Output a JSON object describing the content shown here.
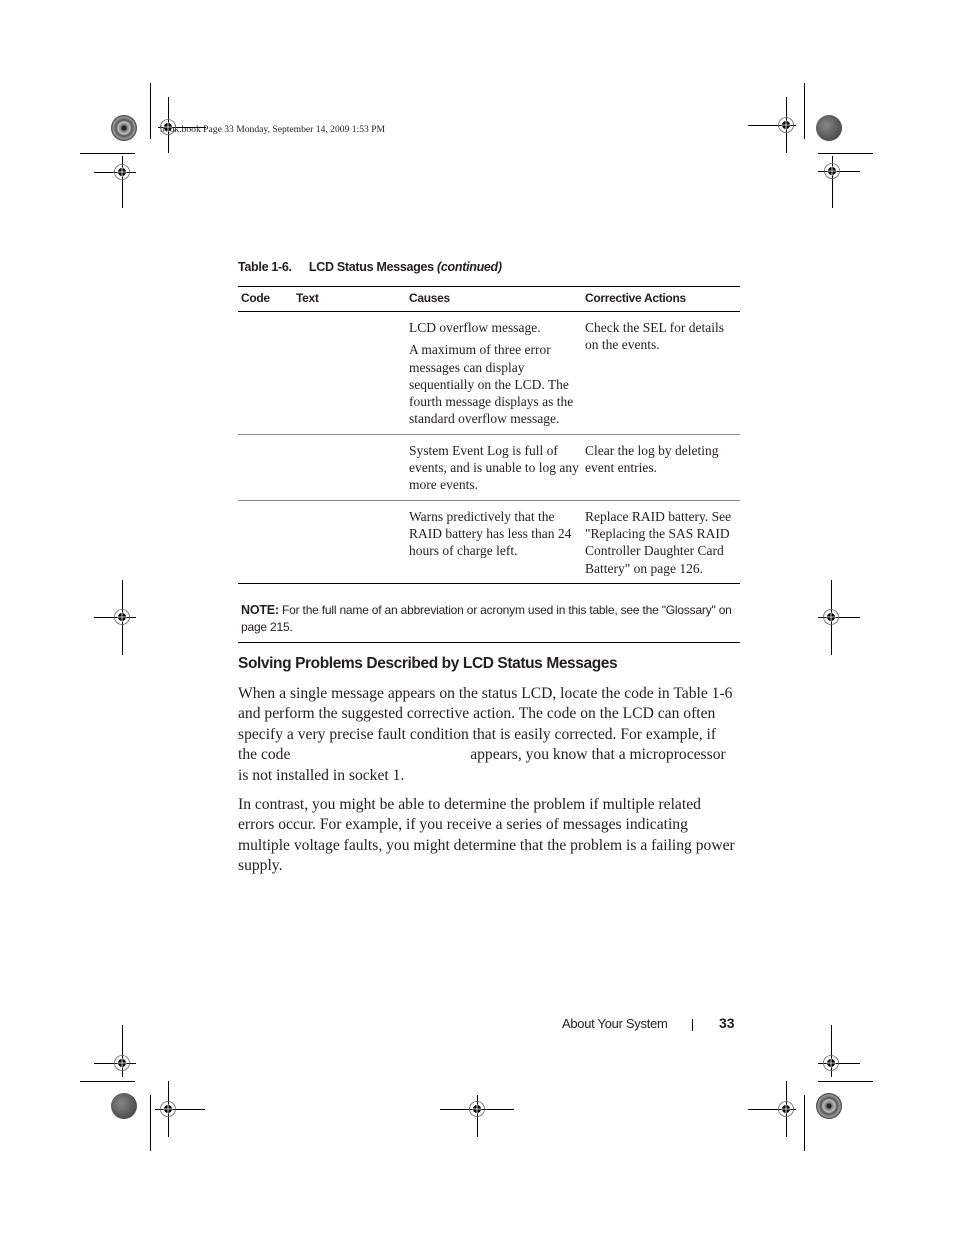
{
  "slug_line": "book.book  Page 33  Monday, September 14, 2009  1:53 PM",
  "table": {
    "caption_number": "Table 1-6.",
    "caption_title": "LCD Status Messages",
    "caption_suffix": "(continued)",
    "headers": [
      "Code",
      "Text",
      "Causes",
      "Corrective Actions"
    ],
    "rows": [
      {
        "code": "",
        "text": "",
        "causes": [
          "LCD overflow message.",
          "A maximum of three error messages can display sequentially on the LCD. The fourth message displays as the standard overflow message."
        ],
        "actions": "Check the SEL for details on the events."
      },
      {
        "code": "",
        "text": "",
        "causes": [
          "System Event Log is full of events, and is unable to log any more events."
        ],
        "actions": "Clear the log by deleting event entries."
      },
      {
        "code": "",
        "text": "",
        "causes": [
          "Warns predictively that the RAID battery has less than 24 hours of charge left."
        ],
        "actions": "Replace RAID battery. See \"Replacing the SAS RAID Controller Daughter Card Battery\" on page 126."
      }
    ]
  },
  "note": {
    "label": "NOTE:",
    "text": " For the full name of an abbreviation or acronym used in this table, see the \"Glossary\" on page 215."
  },
  "section": {
    "heading": "Solving Problems Described by LCD Status Messages",
    "paragraph1_before": "When a single message appears on the status LCD, locate the code in Table 1-6 and perform the suggested corrective action. The code on the LCD can often specify a very precise fault condition that is easily corrected. For example, if the code ",
    "paragraph1_after": " appears, you know that a microprocessor is not installed in socket 1.",
    "paragraph2": "In contrast, you might be able to determine the problem if multiple related errors occur. For example, if you receive a series of messages indicating multiple voltage faults, you might determine that the problem is a failing power supply."
  },
  "footer": {
    "chapter": "About Your System",
    "page_number": "33"
  }
}
